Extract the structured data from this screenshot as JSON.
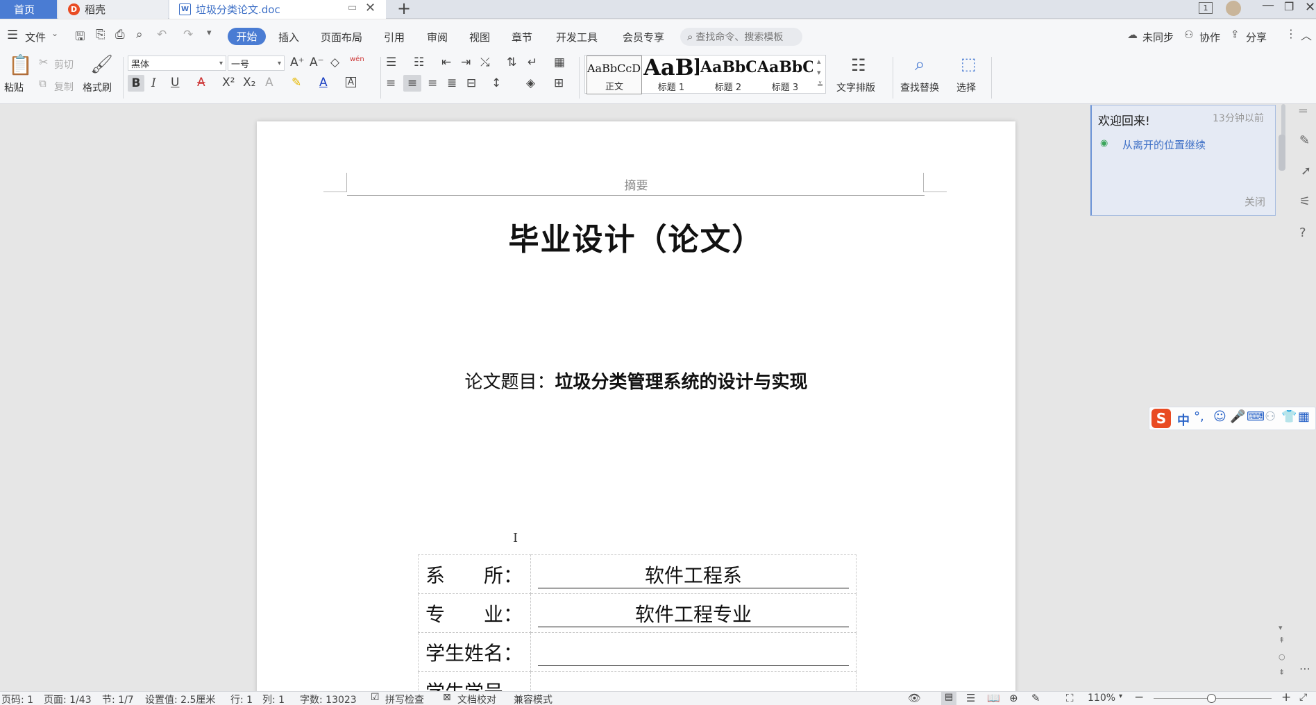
{
  "tabs": {
    "home": "首页",
    "daoke": "稻壳",
    "doc": "垃圾分类论文.doc",
    "window_badge": "1"
  },
  "menu": {
    "file": "文件",
    "items": [
      "开始",
      "插入",
      "页面布局",
      "引用",
      "审阅",
      "视图",
      "章节",
      "开发工具",
      "会员专享"
    ],
    "search_placeholder": "查找命令、搜索模板",
    "right": [
      "未同步",
      "协作",
      "分享"
    ]
  },
  "ribbon": {
    "paste": "粘贴",
    "cut": "剪切",
    "copy": "复制",
    "format_painter": "格式刷",
    "font_family": "黑体",
    "font_size": "一号",
    "pinyin": "wén",
    "styles": [
      {
        "sample": "AaBbCcDd",
        "name": "正文"
      },
      {
        "sample": "AaBl",
        "name": "标题 1"
      },
      {
        "sample": "AaBbC",
        "name": "标题 2"
      },
      {
        "sample": "AaBbC",
        "name": "标题 3"
      }
    ],
    "text_layout": "文字排版",
    "find_replace": "查找替换",
    "select": "选择"
  },
  "document": {
    "header": "摘要",
    "title": "毕业设计（论文）",
    "thesis_label": "论文题目：",
    "thesis_title": "垃圾分类管理系统的设计与实现",
    "fields": [
      {
        "label": "系　　所：",
        "value": "软件工程系"
      },
      {
        "label": "专　　业：",
        "value": "软件工程专业"
      },
      {
        "label": "学生姓名：",
        "value": ""
      },
      {
        "label": "学生学号",
        "value": ""
      }
    ]
  },
  "notify": {
    "title": "欢迎回来!",
    "time": "13分钟以前",
    "link": "从离开的位置继续",
    "close": "关闭"
  },
  "ime": {
    "mode": "中"
  },
  "status": {
    "page_code": "页码: 1",
    "page": "页面: 1/43",
    "section": "节: 1/7",
    "setting": "设置值: 2.5厘米",
    "row": "行: 1",
    "col": "列: 1",
    "word_count": "字数: 13023",
    "spell": "拼写检查",
    "proof": "文档校对",
    "compat": "兼容模式",
    "zoom": "110%"
  },
  "colors": {
    "accent": "#4a7cd3",
    "daoke": "#e94b23",
    "notify_bg": "#e5eaf4"
  }
}
